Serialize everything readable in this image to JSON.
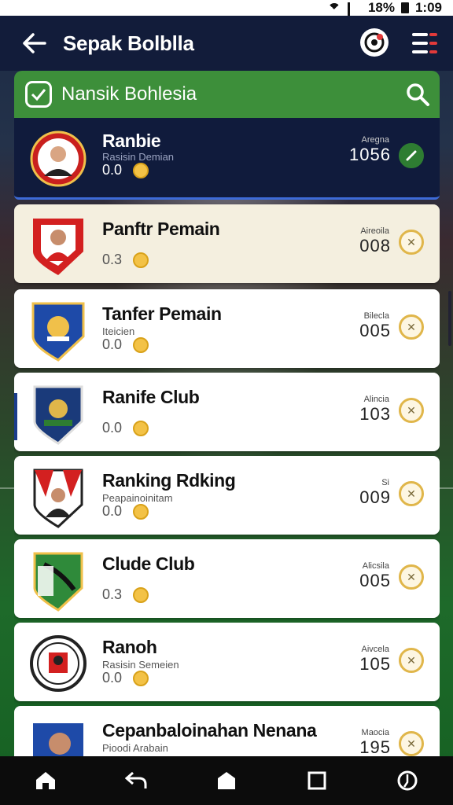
{
  "status_bar": {
    "battery": "18%",
    "time": "1:09"
  },
  "app_bar": {
    "title": "Sepak Bolblla"
  },
  "section": {
    "title": "Nansik Bohlesia"
  },
  "rows": [
    {
      "name": "Ranbie",
      "subtitle": "Rasisin Demian",
      "score": "0.0",
      "rank_label": "Aregna",
      "rank_value": "1056",
      "badge": "check"
    },
    {
      "name": "Panftr Pemain",
      "subtitle": "",
      "score": "0.3",
      "rank_label": "Aireoila",
      "rank_value": "008",
      "badge": "trophy"
    },
    {
      "name": "Tanfer Pemain",
      "subtitle": "Iteicien",
      "score": "0.0",
      "rank_label": "Bilecla",
      "rank_value": "005",
      "badge": "trophy"
    },
    {
      "name": "Ranife Club",
      "subtitle": "",
      "score": "0.0",
      "rank_label": "Alincia",
      "rank_value": "103",
      "badge": "trophy"
    },
    {
      "name": "Ranking Rdking",
      "subtitle": "Peapainoinitam",
      "score": "0.0",
      "rank_label": "Si",
      "rank_value": "009",
      "badge": "trophy"
    },
    {
      "name": "Clude Club",
      "subtitle": "",
      "score": "0.3",
      "rank_label": "Alicsila",
      "rank_value": "005",
      "badge": "trophy"
    },
    {
      "name": "Ranoh",
      "subtitle": "Rasisin Semeien",
      "score": "0.0",
      "rank_label": "Aivcela",
      "rank_value": "105",
      "badge": "trophy"
    },
    {
      "name": "Cepanbaloinahan Nenana",
      "subtitle": "Pioodi Arabain",
      "score": "",
      "rank_label": "Maocia",
      "rank_value": "195",
      "badge": "trophy"
    }
  ],
  "icons": {
    "back": "arrow-left-icon",
    "soccer": "soccer-ball-icon",
    "menu": "menu-icon",
    "search": "search-icon",
    "home": "home-icon",
    "undo": "undo-icon",
    "house": "house-icon",
    "square": "square-icon",
    "compass": "compass-icon"
  },
  "colors": {
    "app_bar": "#121c3a",
    "section_header": "#3d8f3a",
    "featured_row": "#101b3c",
    "badge_gold": "#e0b64a",
    "badge_green": "#2e7d32"
  }
}
